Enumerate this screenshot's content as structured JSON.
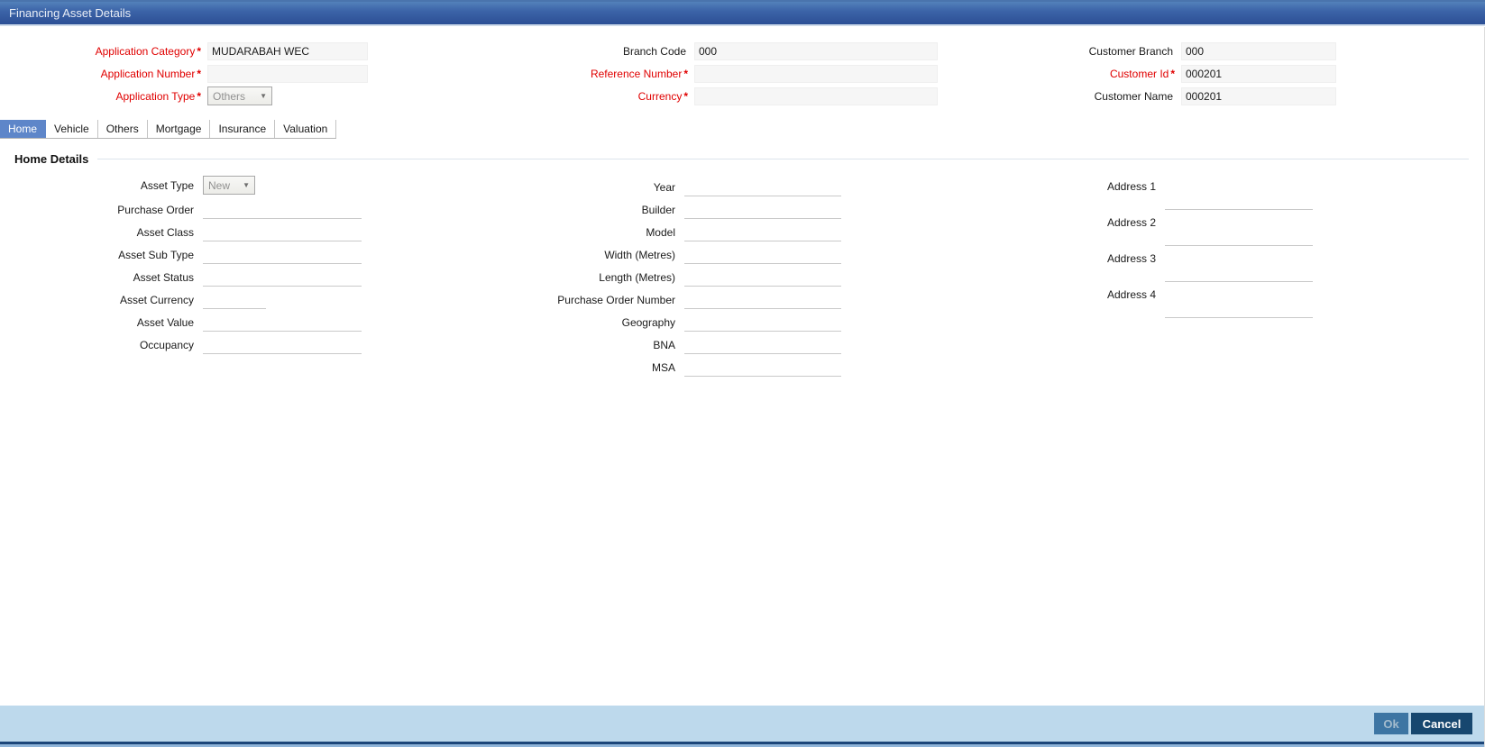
{
  "window": {
    "title": "Financing Asset Details"
  },
  "colors": {
    "titlebar_top": "#5381bb",
    "titlebar_bottom": "#2c4f95",
    "active_tab": "#5e86c9",
    "required_red": "#e00000",
    "footer_bg": "#bdd9ec",
    "ok_button_bg": "#3d75a3",
    "cancel_button_bg": "#17476f"
  },
  "header": {
    "col1": [
      {
        "label": "Application Category",
        "star": "*",
        "value": "MUDARABAH WEC"
      },
      {
        "label": "Application Number",
        "star": "*",
        "value": ""
      },
      {
        "label": "Application Type",
        "star": "*",
        "value": "Others",
        "type": "select"
      }
    ],
    "col2": [
      {
        "label": "Branch Code",
        "star": "",
        "value": "000"
      },
      {
        "label": "Reference Number",
        "star": "*",
        "value": ""
      },
      {
        "label": "Currency",
        "star": "*",
        "value": ""
      }
    ],
    "col3": [
      {
        "label": "Customer Branch",
        "star": "",
        "value": "000"
      },
      {
        "label": "Customer Id",
        "star": "*",
        "value": "000201"
      },
      {
        "label": "Customer Name",
        "star": "",
        "value": "000201"
      }
    ]
  },
  "tabs": [
    {
      "label": "Home",
      "active": true
    },
    {
      "label": "Vehicle",
      "active": false
    },
    {
      "label": "Others",
      "active": false
    },
    {
      "label": "Mortgage",
      "active": false
    },
    {
      "label": "Insurance",
      "active": false
    },
    {
      "label": "Valuation",
      "active": false
    }
  ],
  "section": {
    "title": "Home Details"
  },
  "details": {
    "col1": [
      {
        "label": "Asset Type",
        "value": "New",
        "type": "select"
      },
      {
        "label": "Purchase Order",
        "value": ""
      },
      {
        "label": "Asset Class",
        "value": ""
      },
      {
        "label": "Asset Sub Type",
        "value": ""
      },
      {
        "label": "Asset Status",
        "value": ""
      },
      {
        "label": "Asset Currency",
        "value": "",
        "short": true
      },
      {
        "label": "Asset Value",
        "value": ""
      },
      {
        "label": "Occupancy",
        "value": ""
      }
    ],
    "col2": [
      {
        "label": "Year",
        "value": ""
      },
      {
        "label": "Builder",
        "value": ""
      },
      {
        "label": "Model",
        "value": ""
      },
      {
        "label": "Width (Metres)",
        "value": ""
      },
      {
        "label": "Length (Metres)",
        "value": ""
      },
      {
        "label": "Purchase Order Number",
        "value": ""
      },
      {
        "label": "Geography",
        "value": ""
      },
      {
        "label": "BNA",
        "value": ""
      },
      {
        "label": "MSA",
        "value": ""
      }
    ],
    "col3": [
      {
        "label": "Address 1",
        "value": ""
      },
      {
        "label": "Address 2",
        "value": ""
      },
      {
        "label": "Address 3",
        "value": ""
      },
      {
        "label": "Address 4",
        "value": ""
      }
    ]
  },
  "footer": {
    "ok_label": "Ok",
    "cancel_label": "Cancel"
  }
}
